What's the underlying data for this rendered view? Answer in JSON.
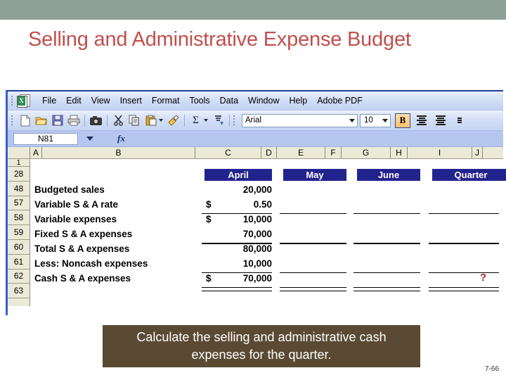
{
  "slide": {
    "title": "Selling and Administrative Expense Budget",
    "title_color": "#c0504d",
    "banner_color": "#8fa096",
    "page_number": "7-66",
    "caption": "Calculate the selling and administrative cash expenses for the quarter.",
    "caption_bg": "#5a4a33"
  },
  "excel": {
    "menu": [
      {
        "label": "File",
        "accel": "F"
      },
      {
        "label": "Edit",
        "accel": "E"
      },
      {
        "label": "View",
        "accel": "V"
      },
      {
        "label": "Insert",
        "accel": "I"
      },
      {
        "label": "Format",
        "accel": "o"
      },
      {
        "label": "Tools",
        "accel": "T"
      },
      {
        "label": "Data",
        "accel": "D"
      },
      {
        "label": "Window",
        "accel": "W"
      },
      {
        "label": "Help",
        "accel": "H"
      },
      {
        "label": "Adobe PDF",
        "accel": "b"
      }
    ],
    "toolbar": {
      "icons": [
        "new-document-icon",
        "open-folder-icon",
        "save-icon",
        "print-icon",
        "print-preview-icon",
        "cut-scissors-icon",
        "copy-icon",
        "paste-icon",
        "format-painter-icon",
        "autosum-icon",
        "sort-icon"
      ],
      "font_name": "Arial",
      "font_size": "10",
      "bold_label": "B",
      "bold_active": true
    },
    "formula_bar": {
      "name_box": "N81",
      "fx_label": "fx",
      "formula": ""
    },
    "column_headers": [
      "A",
      "B",
      "C",
      "D",
      "E",
      "F",
      "G",
      "H",
      "I",
      "J"
    ],
    "row_headers": [
      "1",
      "28",
      "48",
      "57",
      "58",
      "59",
      "60",
      "61",
      "62",
      "63"
    ],
    "table": {
      "period_headers": [
        "April",
        "May",
        "June",
        "Quarter"
      ],
      "header_bg": "#23238e",
      "rows": [
        {
          "label": "Budgeted sales",
          "april": "20,000",
          "april_dollar": "",
          "may": "",
          "june": "",
          "quarter": ""
        },
        {
          "label": "Variable S & A rate",
          "april": "0.50",
          "april_dollar": "$",
          "may": "",
          "june": "",
          "quarter": ""
        },
        {
          "label": "Variable expenses",
          "april": "10,000",
          "april_dollar": "$",
          "may": "",
          "june": "",
          "quarter": ""
        },
        {
          "label": "Fixed S & A expenses",
          "april": "70,000",
          "april_dollar": "",
          "may": "",
          "june": "",
          "quarter": ""
        },
        {
          "label": "Total S & A expenses",
          "april": "80,000",
          "april_dollar": "",
          "may": "",
          "june": "",
          "quarter": ""
        },
        {
          "label": "Less: Noncash expenses",
          "april": "10,000",
          "april_dollar": "",
          "may": "",
          "june": "",
          "quarter": ""
        },
        {
          "label": "Cash S & A expenses",
          "april": "70,000",
          "april_dollar": "$",
          "may": "",
          "june": "",
          "quarter": ""
        }
      ],
      "unknown_marker": "?",
      "unknown_marker_color": "#9b2d20"
    }
  }
}
